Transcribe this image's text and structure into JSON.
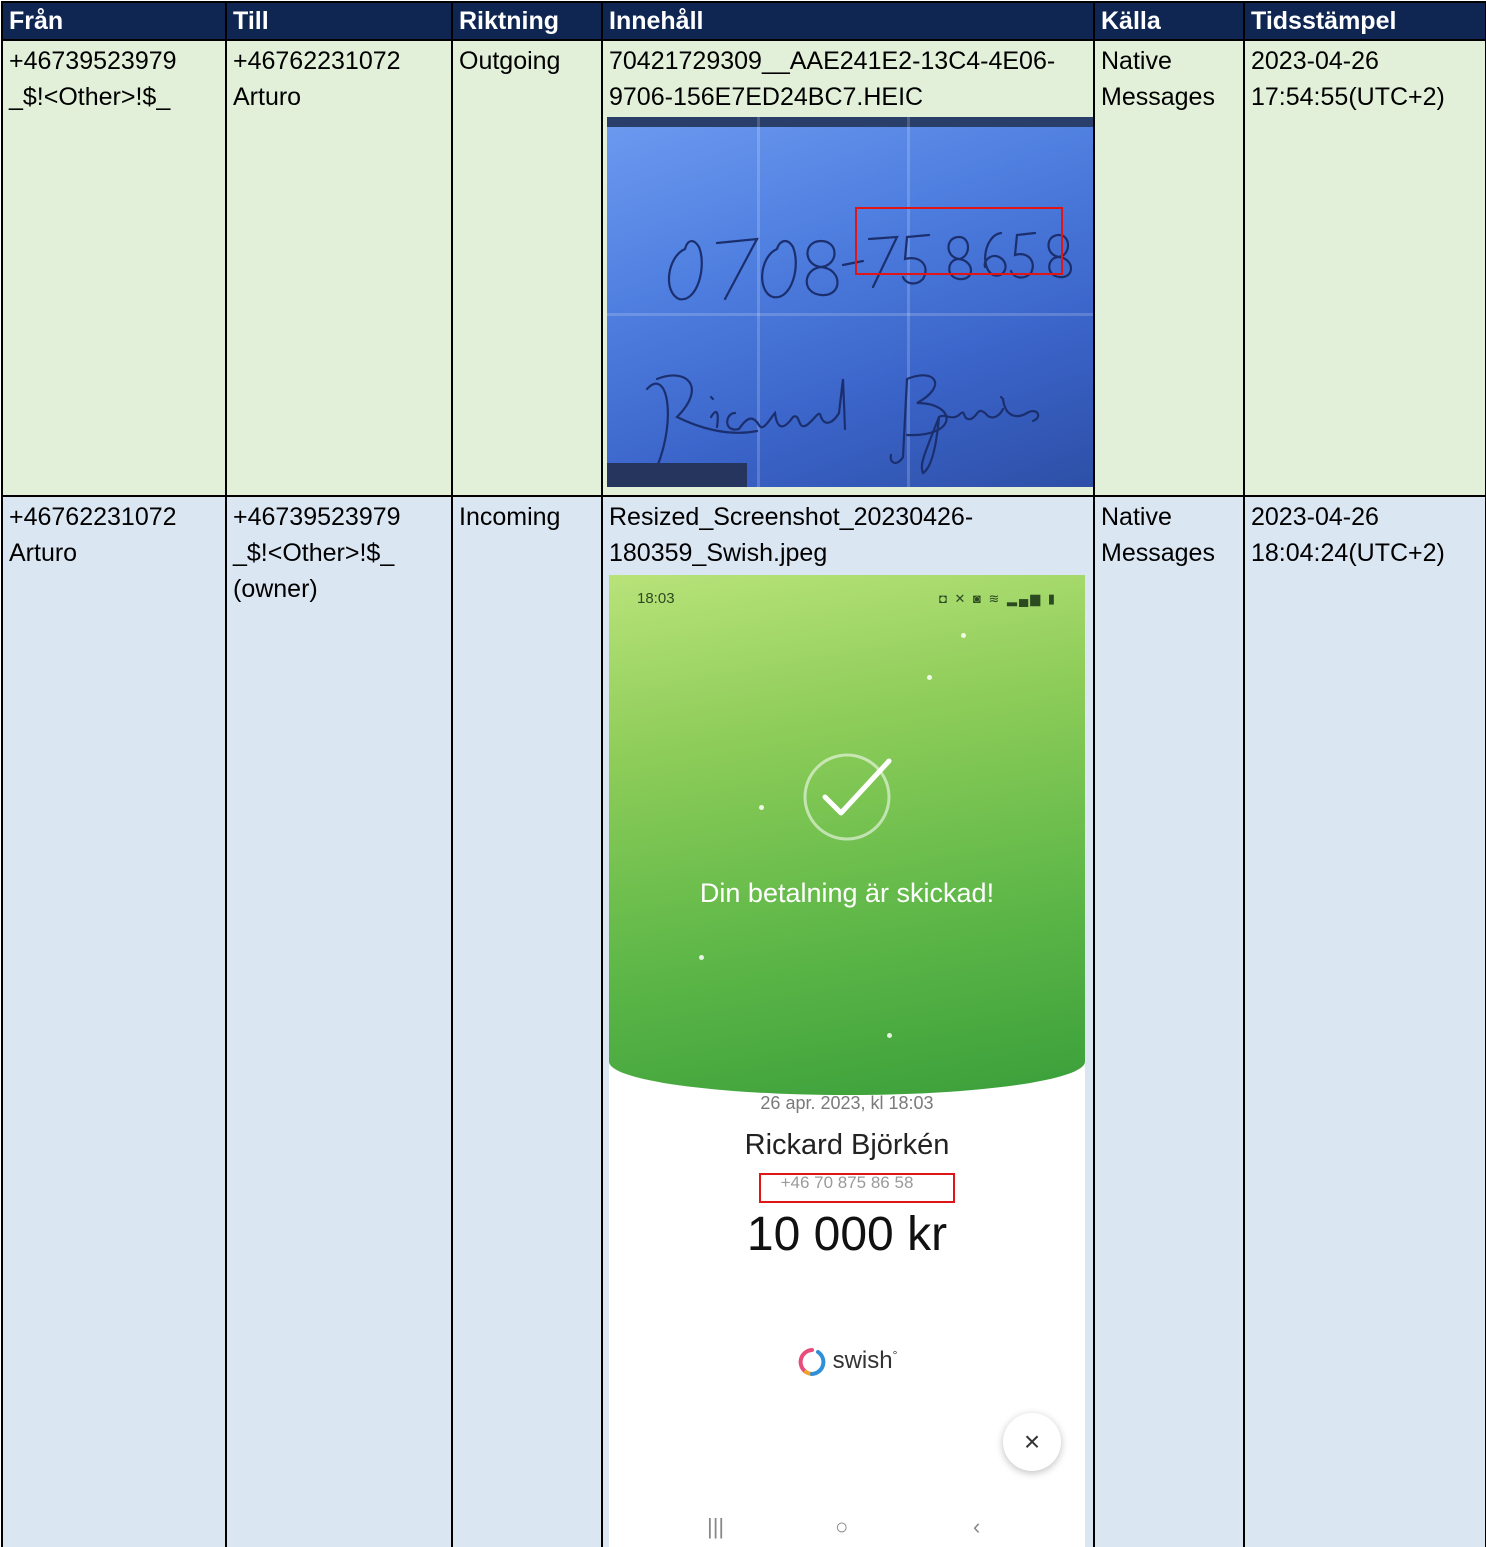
{
  "columns": [
    "Från",
    "Till",
    "Riktning",
    "Innehåll",
    "Källa",
    "Tidsstämpel"
  ],
  "rows": [
    {
      "from": [
        "+46739523979",
        "_$!<Other>!$_"
      ],
      "to": [
        "+46762231072",
        "Arturo"
      ],
      "direction": "Outgoing",
      "content": [
        "70421729309__AAE241E2-13C4-4E06-",
        "9706-156E7ED24BC7.HEIC"
      ],
      "source": [
        "Native",
        "Messages"
      ],
      "timestamp": [
        "2023-04-26",
        "17:54:55(UTC+2)"
      ],
      "attachment": {
        "kind": "photo of handwritten note",
        "handwriting_number": "0708-75 8658",
        "handwriting_signature": "Rickard Björkén"
      }
    },
    {
      "from": [
        "+46762231072",
        "Arturo"
      ],
      "to": [
        "+46739523979",
        "_$!<Other>!$_",
        "(owner)"
      ],
      "direction": "Incoming",
      "content": [
        "Resized_Screenshot_20230426-",
        "180359_Swish.jpeg"
      ],
      "source": [
        "Native",
        "Messages"
      ],
      "timestamp": [
        "2023-04-26",
        "18:04:24(UTC+2)"
      ],
      "attachment": {
        "status_time": "18:03",
        "status_icons": "◘ ✕ ◙ ≋ ▂▄▆ ▮",
        "success_text": "Din betalning är skickad!",
        "date_text": "26 apr. 2023, kl 18:03",
        "recipient_name": "Rickard Björkén",
        "recipient_phone": "+46 70 875 86 58",
        "amount": "10 000 kr",
        "brand": "swish",
        "brand_mark": "°",
        "close_symbol": "×",
        "nav_recent": "|||",
        "nav_home": "○",
        "nav_back": "‹"
      }
    }
  ],
  "colors": {
    "header_bg": "#0f2653",
    "row_outgoing_bg": "#e2efd9",
    "row_incoming_bg": "#dbe6f3",
    "highlight_box": "#e01515"
  }
}
